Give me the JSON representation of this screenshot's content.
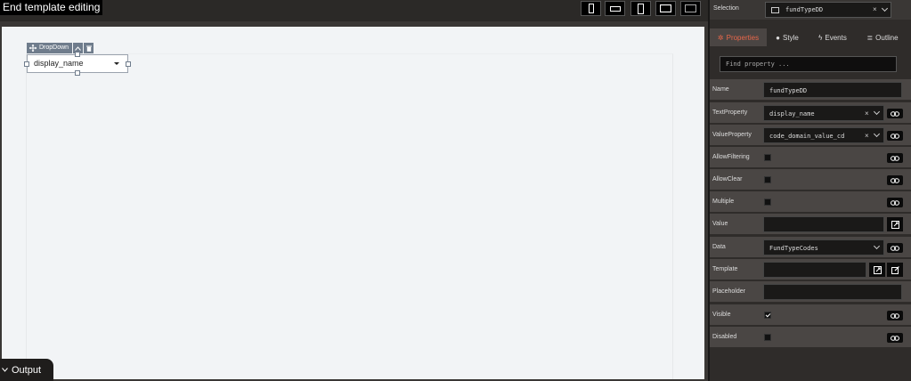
{
  "topbar": {
    "end_editing": "End template editing",
    "devices": [
      "phone-portrait",
      "phone-landscape",
      "tablet-portrait",
      "tablet-landscape",
      "desktop"
    ]
  },
  "canvas": {
    "dropdown_tag": "DropDown",
    "dropdown_value": "display_name"
  },
  "output": {
    "label": "Output"
  },
  "panel": {
    "selection_label": "Selection",
    "selection_value": "fundTypeDD",
    "tabs": [
      {
        "label": "Properties",
        "icon": "gear-icon",
        "active": true
      },
      {
        "label": "Style",
        "icon": "palette-icon",
        "active": false
      },
      {
        "label": "Events",
        "icon": "bolt-icon",
        "active": false
      },
      {
        "label": "Outline",
        "icon": "list-icon",
        "active": false
      }
    ],
    "find_placeholder": "Find property ...",
    "props": {
      "name": {
        "label": "Name",
        "value": "fundTypeDD"
      },
      "text_property": {
        "label": "TextProperty",
        "value": "display_name"
      },
      "value_property": {
        "label": "ValueProperty",
        "value": "code_domain_value_cd"
      },
      "allow_filtering": {
        "label": "AllowFiltering",
        "checked": false
      },
      "allow_clear": {
        "label": "AllowClear",
        "checked": false
      },
      "multiple": {
        "label": "Multiple",
        "checked": false
      },
      "value": {
        "label": "Value",
        "value": ""
      },
      "data": {
        "label": "Data",
        "value": "FundTypeCodes"
      },
      "template": {
        "label": "Template",
        "value": ""
      },
      "placeholder": {
        "label": "Placeholder",
        "value": ""
      },
      "visible": {
        "label": "Visible",
        "checked": true
      },
      "disabled": {
        "label": "Disabled",
        "checked": false
      }
    }
  },
  "colors": {
    "accent": "#e8674a",
    "panel_bg": "#2f2c2a",
    "row_bg": "#4a4644",
    "canvas_bg": "#f2f4f6"
  }
}
